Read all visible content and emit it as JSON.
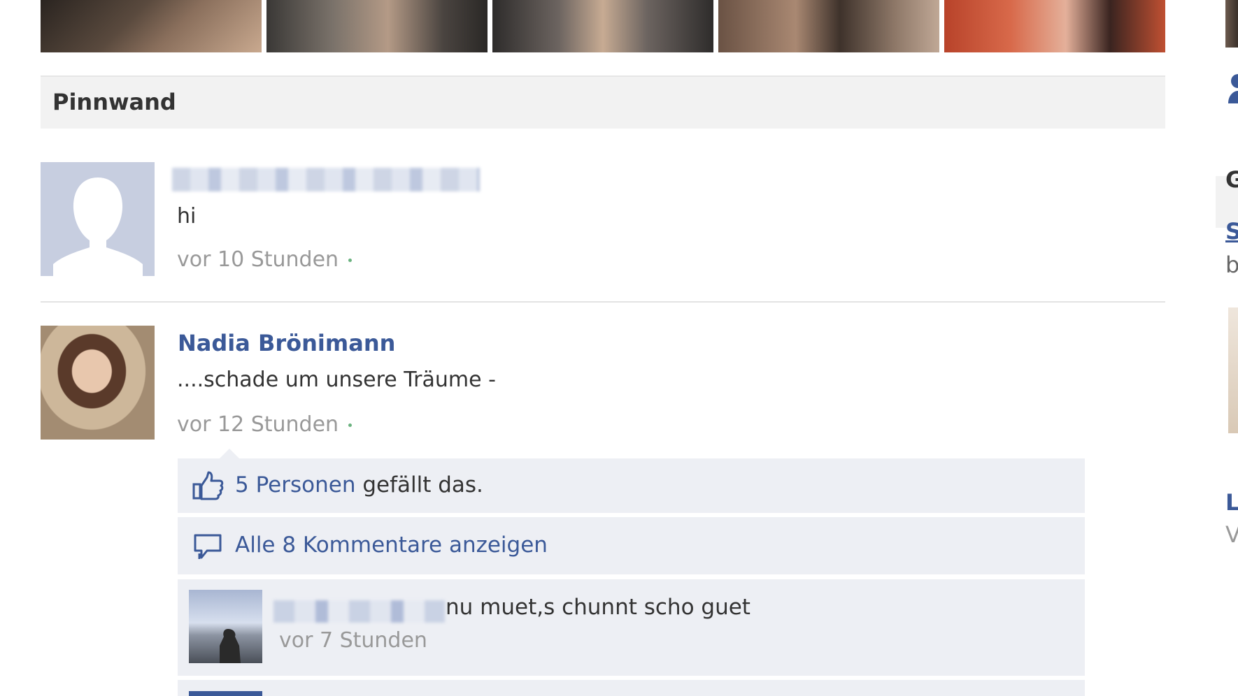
{
  "wall": {
    "title": "Pinnwand"
  },
  "posts": [
    {
      "author": "",
      "text": "hi",
      "time": "vor 10 Stunden"
    },
    {
      "author": "Nadia Brönimann",
      "text": "....schade um unsere Träume -",
      "time": "vor 12 Stunden",
      "likes": "5 Personen",
      "likes_suffix": " gefällt das.",
      "view_comments": "Alle 8 Kommentare anzeigen",
      "comment": {
        "text": "nu muet,s chunnt scho guet",
        "time": "vor 7 Stunden"
      }
    }
  ],
  "right_column": {
    "letters": [
      "G",
      "S",
      "b",
      "L",
      "V"
    ]
  },
  "colors": {
    "link": "#3b5998",
    "header_bg": "#f2f2f2",
    "feedback_bg": "#edeff4",
    "muted": "#999999"
  },
  "icons": {
    "like": "thumbs-up-icon",
    "comments": "speech-bubble-icon"
  }
}
